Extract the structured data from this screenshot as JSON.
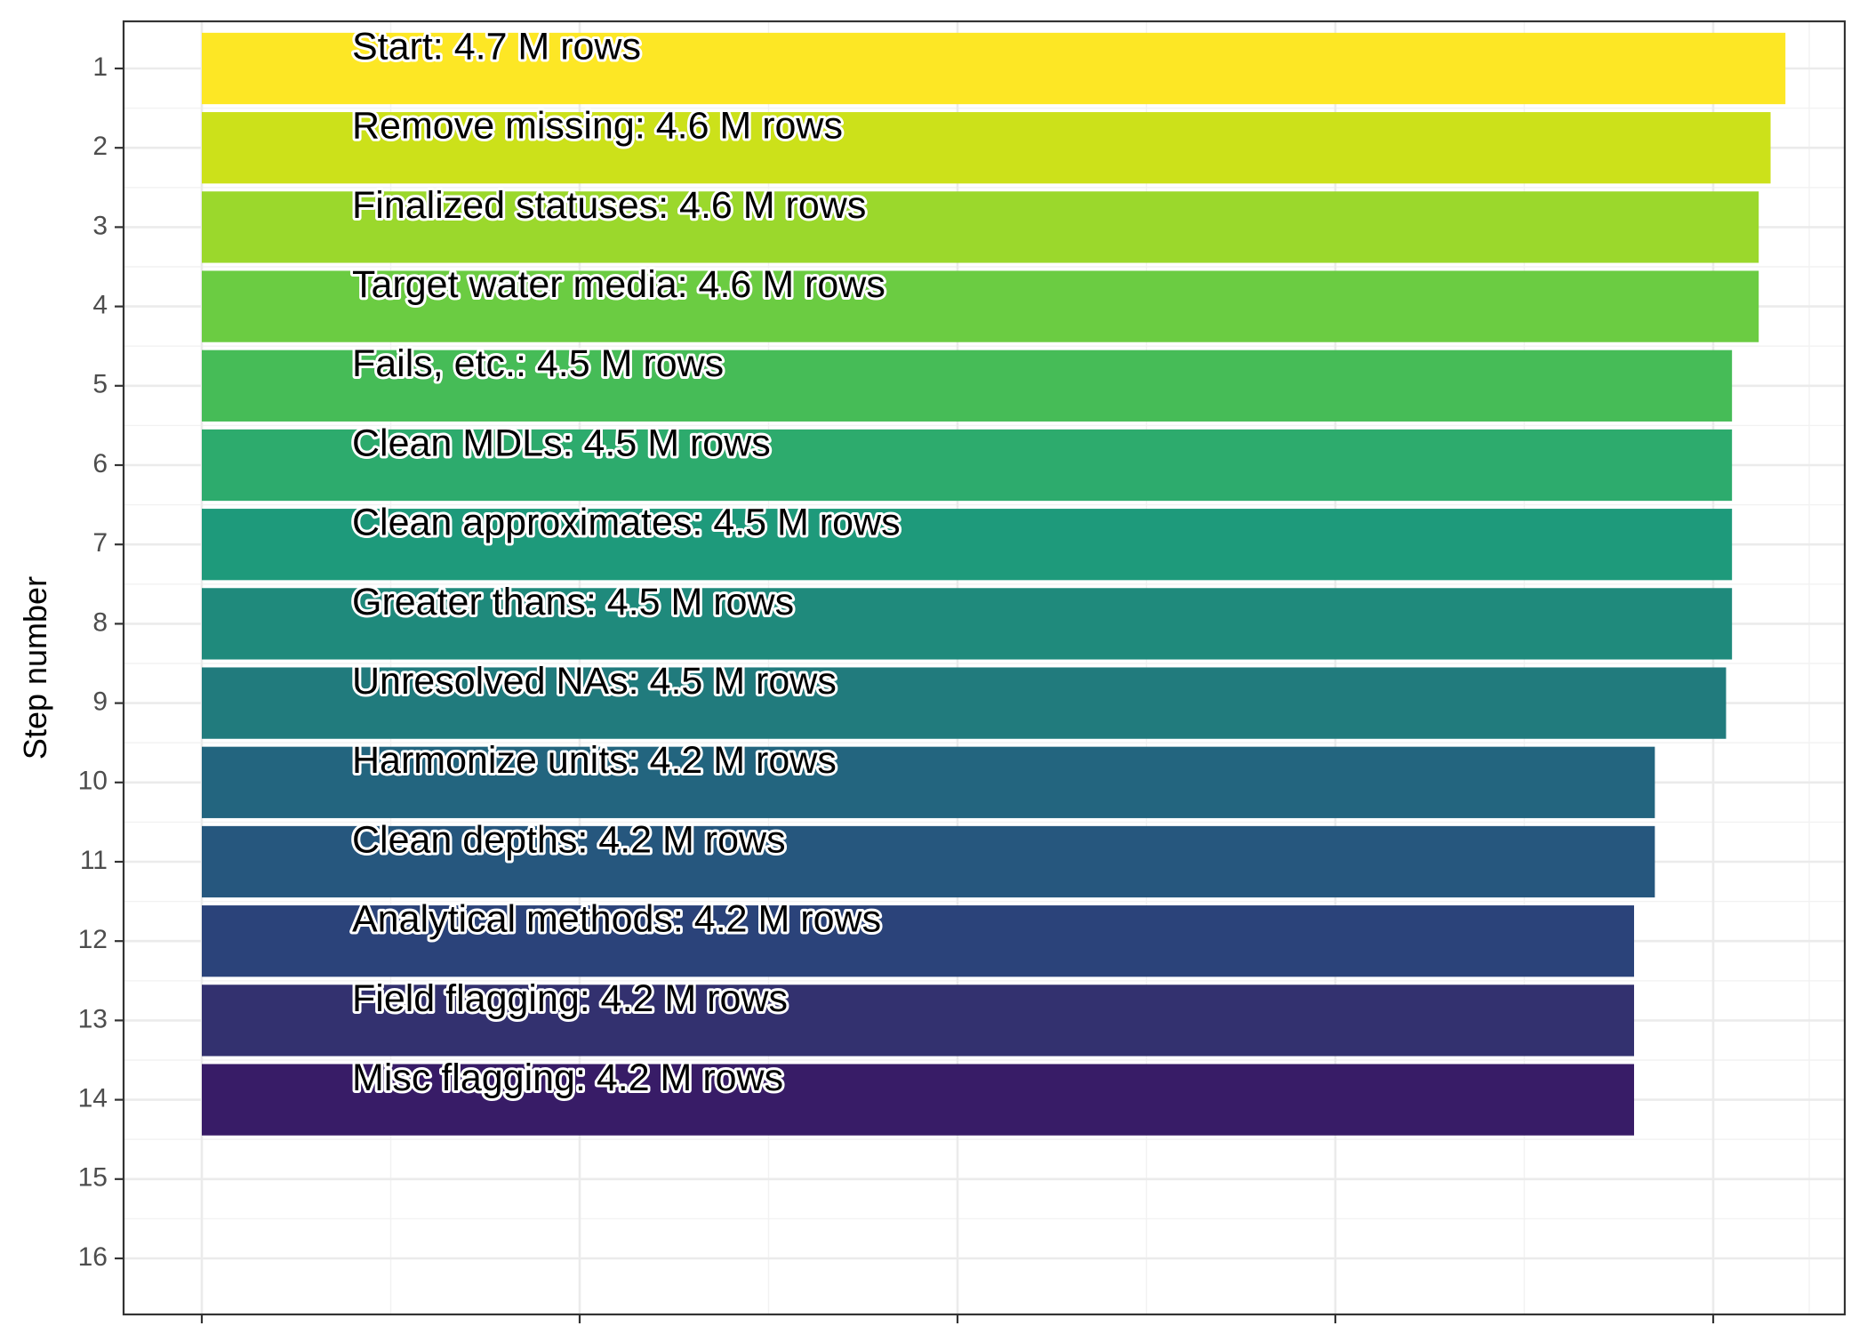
{
  "chart_data": {
    "type": "bar",
    "orientation": "horizontal",
    "ylabel": "Step number",
    "xlabel": "",
    "y_ticks": [
      "1",
      "2",
      "3",
      "4",
      "5",
      "6",
      "7",
      "8",
      "9",
      "10",
      "11",
      "12",
      "13",
      "14",
      "15",
      "16"
    ],
    "ylim": [
      0.4,
      16.6
    ],
    "xlim": [
      4.14,
      4.72
    ],
    "x_range_note": "",
    "grid": true,
    "legend": "none",
    "bars": [
      {
        "step": 1,
        "label": "Start:  4.7 M rows",
        "value": 4.7,
        "color": "#FDE725"
      },
      {
        "step": 2,
        "label": "Remove missing:  4.6 M rows",
        "value": 4.695,
        "color": "#CCE11A"
      },
      {
        "step": 3,
        "label": "Finalized statuses:  4.6 M rows",
        "value": 4.691,
        "color": "#9BD82C"
      },
      {
        "step": 4,
        "label": "Target water media:  4.6 M rows",
        "value": 4.691,
        "color": "#6BCC42"
      },
      {
        "step": 5,
        "label": "Fails, etc.:  4.5 M rows",
        "value": 4.682,
        "color": "#46BC57"
      },
      {
        "step": 6,
        "label": "Clean MDLs:  4.5 M rows",
        "value": 4.682,
        "color": "#2DAB6D"
      },
      {
        "step": 7,
        "label": "Clean approximates:  4.5 M rows",
        "value": 4.682,
        "color": "#1E9A7B"
      },
      {
        "step": 8,
        "label": "Greater thans:  4.5 M rows",
        "value": 4.682,
        "color": "#1F8A7C"
      },
      {
        "step": 9,
        "label": "Unresolved NAs:  4.5 M rows",
        "value": 4.68,
        "color": "#217B7D"
      },
      {
        "step": 10,
        "label": "Harmonize units:  4.2 M rows",
        "value": 4.656,
        "color": "#23657F"
      },
      {
        "step": 11,
        "label": "Clean depths:  4.2 M rows",
        "value": 4.656,
        "color": "#26577E"
      },
      {
        "step": 12,
        "label": "Analytical methods:  4.2 M rows",
        "value": 4.649,
        "color": "#2B437A"
      },
      {
        "step": 13,
        "label": "Field flagging:  4.2 M rows",
        "value": 4.649,
        "color": "#33316F"
      },
      {
        "step": 14,
        "label": "Misc flagging:  4.2 M rows",
        "value": 4.649,
        "color": "#381C67"
      }
    ]
  }
}
